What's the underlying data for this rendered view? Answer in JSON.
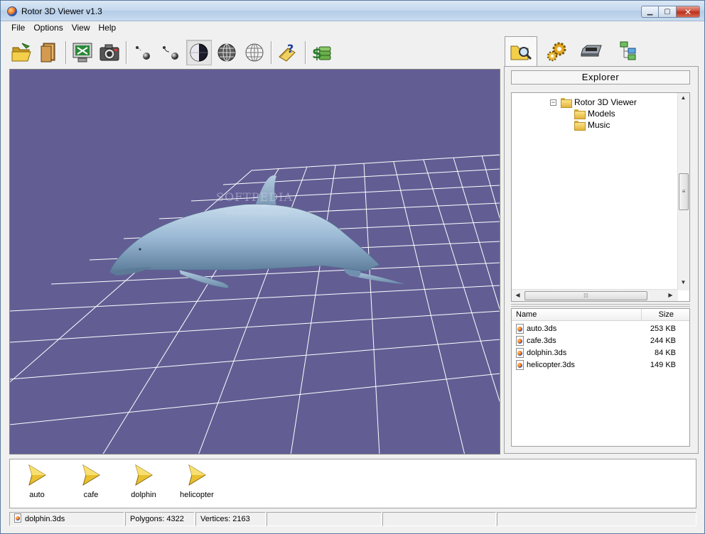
{
  "window": {
    "title": "Rotor 3D Viewer v1.3",
    "min_glyph": "▁",
    "max_glyph": "▢",
    "close_glyph": "✕"
  },
  "menu": {
    "items": [
      "File",
      "Options",
      "View",
      "Help"
    ]
  },
  "toolbar": {
    "icons": [
      "open-folder-icon",
      "open-model-icon",
      "screen-capture-icon",
      "camera-icon",
      "points-mode-icon",
      "lines-mode-icon",
      "solid-mode-icon",
      "wireframe-globe-icon",
      "grid-globe-icon",
      "help-icon",
      "register-icon"
    ],
    "pressed": [
      "solid-mode-icon"
    ]
  },
  "viewport": {
    "background": "#625e94",
    "watermark": "SOFTPEDIA",
    "watermark_url": "www.softpedia.com"
  },
  "side_tabs": {
    "icons": [
      "explorer-tab-icon",
      "settings-tab-icon",
      "device-tab-icon",
      "tree-tab-icon"
    ],
    "active": 0
  },
  "explorer": {
    "title": "Explorer",
    "tree": [
      {
        "label": "Rotor 3D Viewer",
        "toggle": "−",
        "level": 0
      },
      {
        "label": "Models",
        "level": 1
      },
      {
        "label": "Music",
        "level": 1
      }
    ],
    "scroll_glyphs": {
      "up": "▲",
      "down": "▼",
      "left": "◀",
      "right": "▶",
      "grip_v": "≡",
      "grip_h": "⁞⁞⁞"
    }
  },
  "file_list": {
    "columns": {
      "name": "Name",
      "size": "Size"
    },
    "files": [
      {
        "name": "auto.3ds",
        "size": "253 KB"
      },
      {
        "name": "cafe.3ds",
        "size": "244 KB"
      },
      {
        "name": "dolphin.3ds",
        "size": "84 KB"
      },
      {
        "name": "helicopter.3ds",
        "size": "149 KB"
      }
    ]
  },
  "models": [
    "auto",
    "cafe",
    "dolphin",
    "helicopter"
  ],
  "status": {
    "file": "dolphin.3ds",
    "polygons": "Polygons: 4322",
    "vertices": "Vertices: 2163"
  }
}
